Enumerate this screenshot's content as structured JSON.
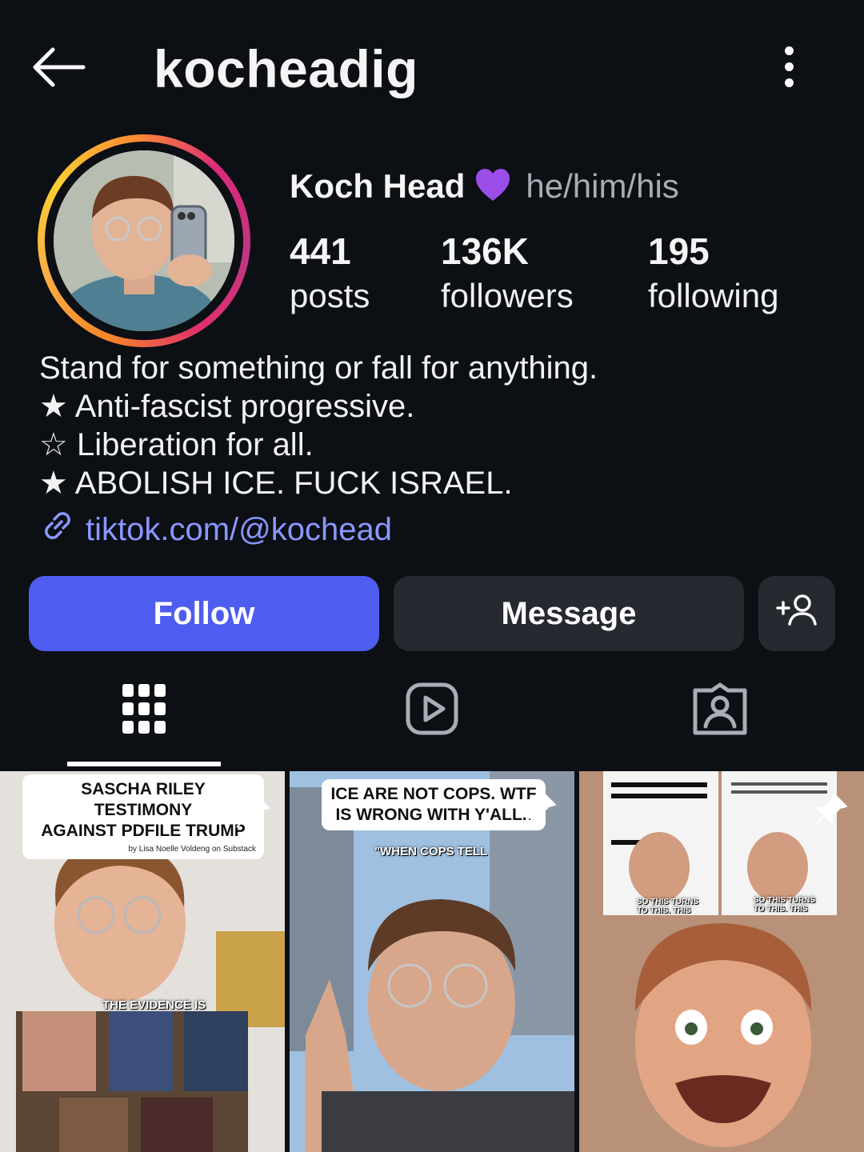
{
  "header": {
    "username": "kocheadig",
    "back_icon": "arrow-left-icon",
    "more_icon": "vertical-ellipsis-icon"
  },
  "profile": {
    "display_name": "Koch Head",
    "emoji_icon": "purple-heart-icon",
    "pronouns": "he/him/his",
    "story_ring_colors": [
      "#f58529",
      "#fcaf45",
      "#dd2a7b",
      "#c13584"
    ]
  },
  "stats": [
    {
      "value": "441",
      "label": "posts"
    },
    {
      "value": "136K",
      "label": "followers"
    },
    {
      "value": "195",
      "label": "following"
    }
  ],
  "bio": {
    "lines": [
      "Stand for something or fall for anything.",
      "★ Anti-fascist progressive.",
      "☆ Liberation for all.",
      "★ ABOLISH ICE. FUCK ISRAEL."
    ],
    "link_icon": "link-icon",
    "link_text": "tiktok.com/@kochead",
    "link_color": "#8a97ff"
  },
  "actions": {
    "follow_label": "Follow",
    "follow_color": "#4e5cf0",
    "message_label": "Message",
    "add_user_icon": "add-person-icon"
  },
  "tabs": [
    {
      "name": "grid",
      "icon": "grid-icon",
      "active": true
    },
    {
      "name": "reels",
      "icon": "reels-play-icon",
      "active": false
    },
    {
      "name": "tagged",
      "icon": "tagged-person-icon",
      "active": false
    }
  ],
  "posts": [
    {
      "caption_line1": "SASCHA RILEY TESTIMONY",
      "caption_line2": "AGAINST PDFILE TRUMP",
      "byline": "by Lisa Noelle Voldeng on Substack",
      "overlay": "THE EVIDENCE IS",
      "pinned": true
    },
    {
      "caption_line1": "ICE ARE NOT COPS. WTF",
      "caption_line2": "IS WRONG WITH Y'ALL..",
      "overlay": "\"WHEN COPS TELL",
      "pinned": true
    },
    {
      "overlay_left": "SO THIS TURNS TO THIS. THIS",
      "overlay_right": "SO THIS TURNS TO THIS. THIS",
      "pinned": true
    }
  ]
}
